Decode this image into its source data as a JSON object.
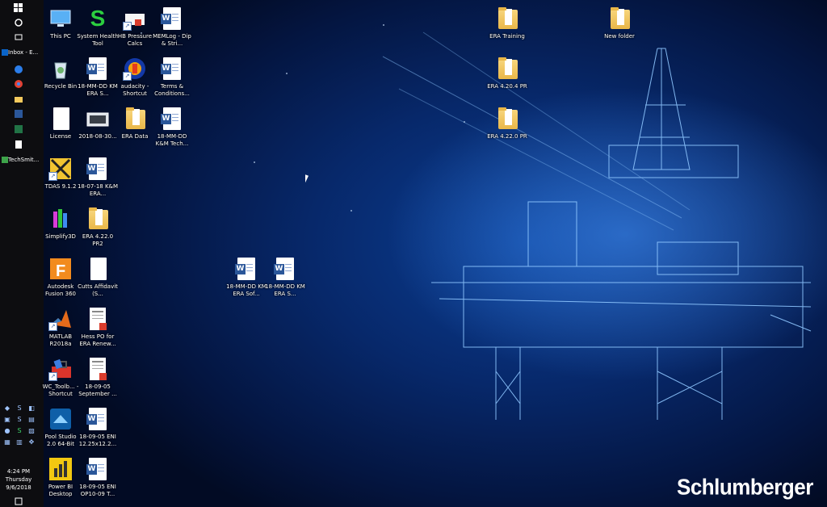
{
  "taskbar": {
    "start_icon": "windows-logo-icon",
    "pinned": [
      {
        "name": "search-icon"
      },
      {
        "name": "task-view-icon"
      },
      {
        "name": "outlook-icon",
        "label": "Inbox - E..."
      },
      {
        "name": "edge-icon"
      },
      {
        "name": "chrome-icon"
      },
      {
        "name": "file-explorer-icon"
      },
      {
        "name": "word-icon"
      },
      {
        "name": "excel-icon"
      },
      {
        "name": "document-icon"
      },
      {
        "name": "techsmith-icon",
        "label": "TechSmit..."
      }
    ],
    "clock": {
      "time": "4:24 PM",
      "day": "Thursday",
      "date": "9/6/2018"
    }
  },
  "desktop": {
    "icons": [
      {
        "label": "This PC",
        "type": "this-pc"
      },
      {
        "label": "System Health Tool",
        "type": "green-s"
      },
      {
        "label": "HB Pressure Calcs",
        "type": "pdf",
        "shortcut": true
      },
      {
        "label": "MEMLog - Dip & Stri...",
        "type": "word"
      },
      {
        "label": "Recycle Bin",
        "type": "recycle"
      },
      {
        "label": "18-MM-DD KM ERA S...",
        "type": "word"
      },
      {
        "label": "audacity - Shortcut",
        "type": "audacity",
        "shortcut": true
      },
      {
        "label": "Terms & Conditions...",
        "type": "word"
      },
      {
        "label": "License",
        "type": "plain"
      },
      {
        "label": "2018-08-30...",
        "type": "video"
      },
      {
        "label": "ERA Data",
        "type": "folder"
      },
      {
        "label": "18-MM-DD K&M Tech...",
        "type": "word"
      },
      {
        "label": "TDAS 9.1.2",
        "type": "tdas",
        "shortcut": true
      },
      {
        "label": "18-07-18 K&M ERA...",
        "type": "word"
      },
      {
        "label": "Simplify3D",
        "type": "simplify3d"
      },
      {
        "label": "ERA 4.22.0 PR2",
        "type": "folder"
      },
      {
        "label": "Autodesk Fusion 360",
        "type": "fusion"
      },
      {
        "label": "Cutts Affidavit (S...",
        "type": "plain"
      },
      {
        "label": "MATLAB R2018a",
        "type": "matlab",
        "shortcut": true
      },
      {
        "label": "Hess PO for ERA Renew...",
        "type": "pdf-doc"
      },
      {
        "label": "WC_Toolb... - Shortcut",
        "type": "toolbox",
        "shortcut": true
      },
      {
        "label": "18-09-05 September ...",
        "type": "pdf-doc"
      },
      {
        "label": "Pool Studio 2.0 64-Bit",
        "type": "pool"
      },
      {
        "label": "18-09-05 ENI 12.25x12.2...",
        "type": "word"
      },
      {
        "label": "Power BI Desktop",
        "type": "powerbi"
      },
      {
        "label": "18-09-05 ENI OP10-09 T...",
        "type": "word"
      },
      {
        "label": "ERA Training",
        "type": "folder"
      },
      {
        "label": "New folder",
        "type": "folder"
      },
      {
        "label": "ERA 4.20.4 PR",
        "type": "folder"
      },
      {
        "label": "ERA 4.22.0 PR",
        "type": "folder"
      },
      {
        "label": "18-MM-DD KM ERA Sof...",
        "type": "word"
      },
      {
        "label": "18-MM-DD KM ERA S...",
        "type": "word"
      }
    ]
  },
  "wallpaper": {
    "brand": "Schlumberger",
    "accent": "#0b3f95"
  }
}
